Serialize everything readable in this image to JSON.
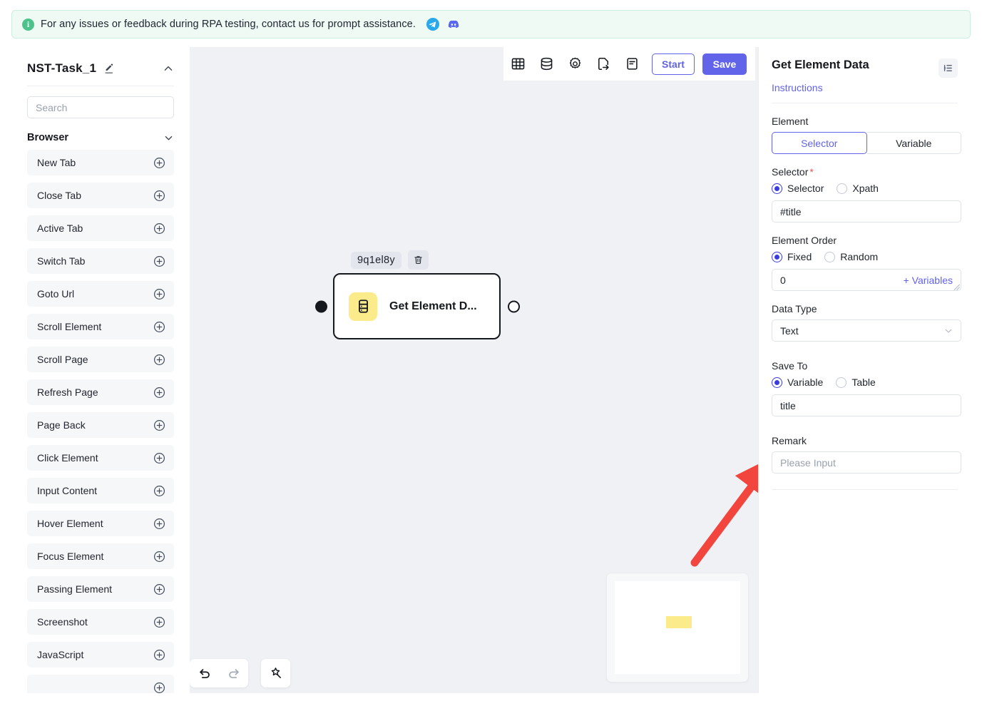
{
  "notice": {
    "icon": "info-icon",
    "text": "For any issues or feedback during RPA testing, contact us for prompt assistance.",
    "social": [
      {
        "name": "telegram-icon",
        "color": "#29a9eb"
      },
      {
        "name": "discord-icon",
        "color": "#5865f2"
      }
    ],
    "bg": "#eefaf3",
    "border": "#cdeede"
  },
  "sidebar": {
    "title": "NST-Task_1",
    "edit_icon": "pencil-icon",
    "collapse_icon": "chevron-up-icon",
    "search": {
      "placeholder": "Search",
      "value": ""
    },
    "group": {
      "label": "Browser",
      "chevron": "chevron-down-icon"
    },
    "items": [
      {
        "label": "New Tab"
      },
      {
        "label": "Close Tab"
      },
      {
        "label": "Active Tab"
      },
      {
        "label": "Switch Tab"
      },
      {
        "label": "Goto Url"
      },
      {
        "label": "Scroll Element"
      },
      {
        "label": "Scroll Page"
      },
      {
        "label": "Refresh Page"
      },
      {
        "label": "Page Back"
      },
      {
        "label": "Click Element"
      },
      {
        "label": "Input Content"
      },
      {
        "label": "Hover Element"
      },
      {
        "label": "Focus Element"
      },
      {
        "label": "Passing Element"
      },
      {
        "label": "Screenshot"
      },
      {
        "label": "JavaScript"
      },
      {
        "label": ""
      }
    ],
    "add_icon": "plus-circle-icon"
  },
  "toolbar": {
    "icons": [
      {
        "name": "table-icon"
      },
      {
        "name": "database-icon"
      },
      {
        "name": "gear-icon"
      },
      {
        "name": "export-file-icon"
      },
      {
        "name": "log-icon"
      }
    ],
    "start_label": "Start",
    "save_label": "Save",
    "accent": "#6163e8"
  },
  "canvas": {
    "background": "#f0f1f5",
    "node": {
      "id": "9q1el8y",
      "delete_icon": "trash-icon",
      "icon": "database-stack-icon",
      "icon_bg": "#fbeb8a",
      "title": "Get Element D...",
      "port_in": "input-port",
      "port_out": "output-port"
    },
    "controls": [
      {
        "name": "undo-icon"
      },
      {
        "name": "redo-icon"
      },
      {
        "name": "auto-layout-icon"
      }
    ],
    "minimap": {
      "name": "minimap",
      "node_color": "#fbeb8a"
    },
    "annotation": {
      "name": "red-arrow-annotation",
      "color": "#f2453d"
    }
  },
  "panel": {
    "title": "Get Element Data",
    "collapse_icon": "panel-collapse-icon",
    "instructions_label": "Instructions",
    "accent": "#6163e8",
    "element": {
      "label": "Element",
      "options": [
        "Selector",
        "Variable"
      ],
      "selected": "Selector"
    },
    "selector": {
      "label": "Selector",
      "required_mark": "*",
      "radios": [
        "Selector",
        "Xpath"
      ],
      "selected": "Selector",
      "value": "#title",
      "placeholder": ""
    },
    "element_order": {
      "label": "Element Order",
      "radios": [
        "Fixed",
        "Random"
      ],
      "selected": "Fixed",
      "value": "0",
      "variables_label": "+ Variables"
    },
    "data_type": {
      "label": "Data Type",
      "value": "Text",
      "chevron": "chevron-down-icon"
    },
    "save_to": {
      "label": "Save To",
      "radios": [
        "Variable",
        "Table"
      ],
      "selected": "Variable",
      "value": "title"
    },
    "remark": {
      "label": "Remark",
      "value": "",
      "placeholder": "Please Input"
    }
  }
}
